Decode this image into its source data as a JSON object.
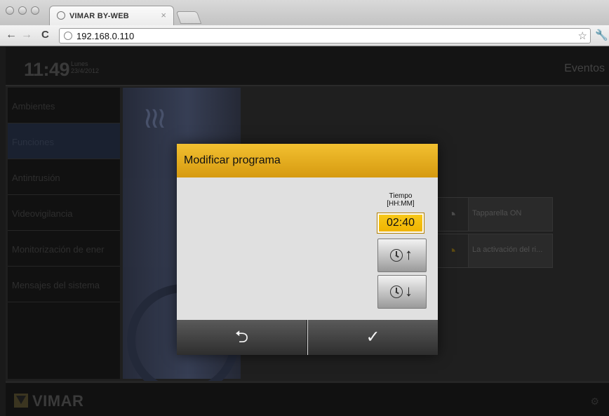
{
  "browser": {
    "tab_title": "VIMAR BY-WEB",
    "tab_close": "×",
    "url": "192.168.0.110",
    "back_glyph": "←",
    "forward_glyph": "→",
    "reload_glyph": "C",
    "star_glyph": "☆",
    "wrench_glyph": "🔧"
  },
  "header": {
    "time": "11:49",
    "day": "Lunes",
    "date": "23/4/2012",
    "title": "Eventos"
  },
  "sidebar": {
    "items": [
      {
        "label": "Ambientes"
      },
      {
        "label": "Funciones"
      },
      {
        "label": "Antintrusión"
      },
      {
        "label": "Videovigilancia"
      },
      {
        "label": "Monitorización de ener"
      },
      {
        "label": "Mensajes del sistema"
      }
    ]
  },
  "center_panel": {
    "waves_glyph": "≀≀≀"
  },
  "cards": [
    {
      "label": "Tapparella ON",
      "icon": "gauge-icon",
      "glyph": "◔"
    },
    {
      "label": "La activación del ri...",
      "icon": "gauge-warning-icon",
      "glyph": "◔"
    }
  ],
  "dialog": {
    "title": "Modificar programa",
    "time_label_line1": "Tiempo",
    "time_label_line2": "[HH:MM]",
    "time_value": "02:40",
    "up_glyph": "↑",
    "down_glyph": "↓",
    "back_glyph": "⮌",
    "confirm_glyph": "✓"
  },
  "footer": {
    "logo_text": "VIMAR",
    "corner_glyph": "⚙"
  },
  "colors": {
    "accent": "#e8ae1c",
    "time_field": "#f5c010"
  }
}
